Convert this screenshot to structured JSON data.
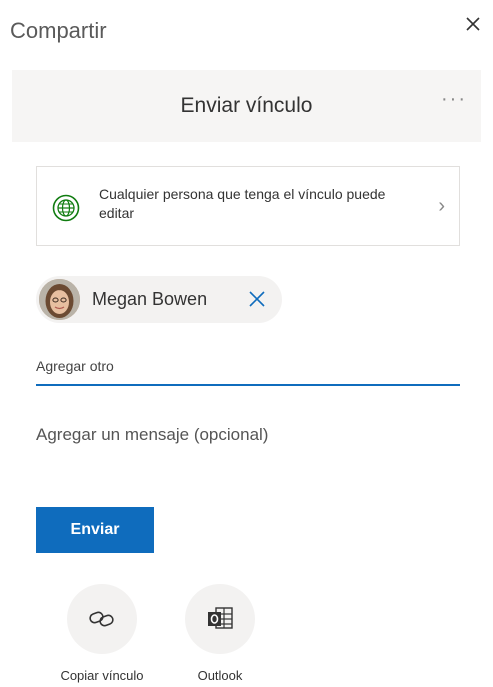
{
  "dialog": {
    "title": "Compartir",
    "close_icon": "close-icon"
  },
  "header": {
    "title": "Enviar vínculo",
    "more_label": "···"
  },
  "permission": {
    "icon": "globe-icon",
    "text": "Cualquier persona que tenga el vínculo puede editar",
    "chevron": "›"
  },
  "recipients": [
    {
      "name": "Megan Bowen",
      "avatar": "avatar-photo"
    }
  ],
  "add_input": {
    "placeholder": "Agregar otro",
    "value": ""
  },
  "message": {
    "placeholder": "Agregar un mensaje (opcional)"
  },
  "send_button": {
    "label": "Enviar",
    "color": "#0f6cbd"
  },
  "share_options": [
    {
      "label": "Copiar vínculo",
      "icon": "link-icon"
    },
    {
      "label": "Outlook",
      "icon": "outlook-icon"
    }
  ],
  "colors": {
    "accent": "#0f6cbd",
    "globe": "#107c10",
    "header_bg": "#f6f5f4"
  }
}
